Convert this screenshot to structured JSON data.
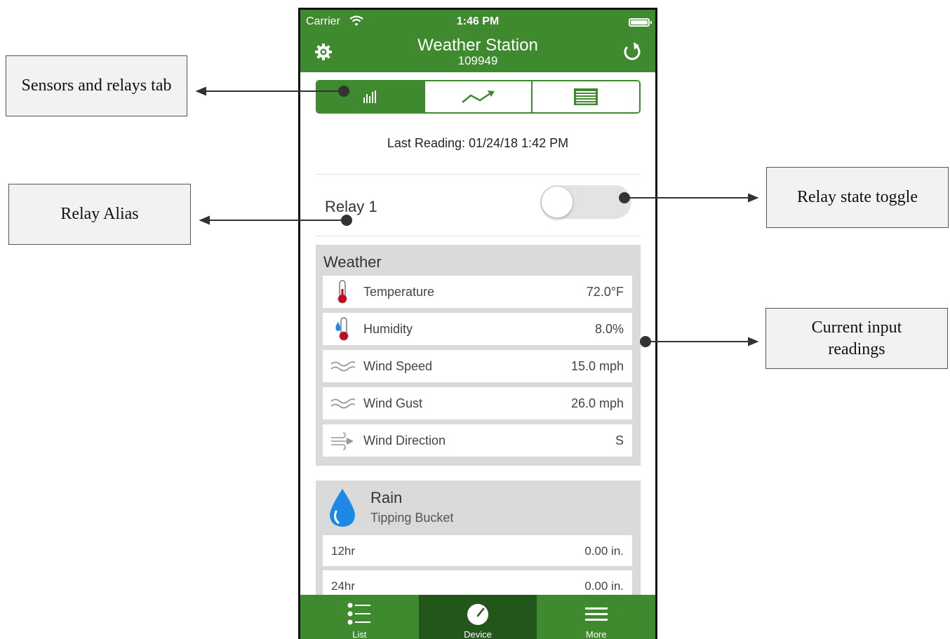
{
  "annotations": {
    "sensors_tab": "Sensors and relays tab",
    "relay_alias": "Relay Alias",
    "relay_toggle": "Relay state toggle",
    "current_readings": "Current input readings"
  },
  "status_bar": {
    "carrier": "Carrier",
    "time": "1:46 PM"
  },
  "header": {
    "title": "Weather Station",
    "subtitle": "109949",
    "left_icon": "gear-icon",
    "right_icon": "refresh-icon"
  },
  "segments": [
    {
      "icon": "bar-chart-icon",
      "selected": true
    },
    {
      "icon": "trend-line-icon",
      "selected": false
    },
    {
      "icon": "table-icon",
      "selected": false
    }
  ],
  "last_reading": "Last Reading: 01/24/18 1:42 PM",
  "relay": {
    "label": "Relay 1",
    "state": "off"
  },
  "weather": {
    "title": "Weather",
    "rows": [
      {
        "label": "Temperature",
        "value": "72.0°F",
        "icon": "thermometer-icon"
      },
      {
        "label": "Humidity",
        "value": "8.0%",
        "icon": "humidity-icon"
      },
      {
        "label": "Wind Speed",
        "value": "15.0 mph",
        "icon": "wind-icon"
      },
      {
        "label": "Wind Gust",
        "value": "26.0 mph",
        "icon": "wind-icon"
      },
      {
        "label": "Wind Direction",
        "value": "S",
        "icon": "wind-direction-icon"
      }
    ]
  },
  "rain": {
    "title": "Rain",
    "subtitle": "Tipping Bucket",
    "rows": [
      {
        "label": "12hr",
        "value": "0.00 in."
      },
      {
        "label": "24hr",
        "value": "0.00 in."
      }
    ]
  },
  "tabs": [
    {
      "label": "List",
      "icon": "list-icon",
      "active": false
    },
    {
      "label": "Device",
      "icon": "gauge-icon",
      "active": true
    },
    {
      "label": "More",
      "icon": "menu-icon",
      "active": false
    }
  ],
  "colors": {
    "brand_green": "#3f8a2e",
    "active_tab": "#23561a",
    "panel_gray": "#dadada"
  }
}
